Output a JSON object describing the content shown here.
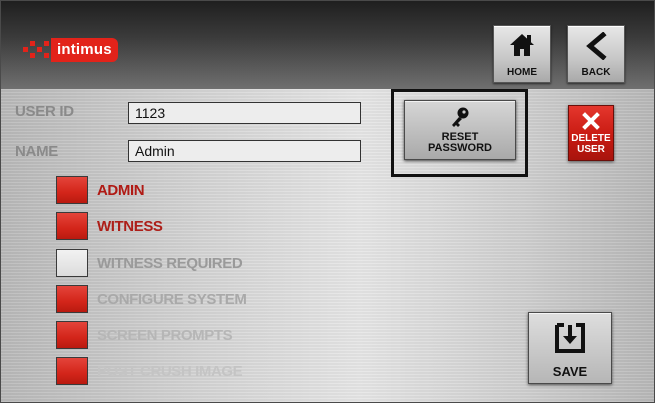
{
  "header": {
    "logo_text": "intimus",
    "home_label": "HOME",
    "back_label": "BACK"
  },
  "user": {
    "id_label": "USER ID",
    "id_value": "1123",
    "name_label": "NAME",
    "name_value": "Admin"
  },
  "permissions": [
    {
      "label": "ADMIN",
      "checked": true,
      "color": "#b01a14"
    },
    {
      "label": "WITNESS",
      "checked": true,
      "color": "#ad1e18"
    },
    {
      "label": "WITNESS REQUIRED",
      "checked": false,
      "color": "#9a9a9a"
    },
    {
      "label": "CONFIGURE SYSTEM",
      "checked": true,
      "color": "#a9a9a9"
    },
    {
      "label": "SCREEN PROMPTS",
      "checked": true,
      "color": "#b6b6b6"
    },
    {
      "label": "POST CRUSH IMAGE",
      "checked": true,
      "color": "#c4c4c4"
    }
  ],
  "actions": {
    "reset_label": "RESET PASSWORD",
    "delete_label": "DELETE USER",
    "save_label": "SAVE"
  },
  "colors": {
    "accent_red": "#e2231a"
  }
}
